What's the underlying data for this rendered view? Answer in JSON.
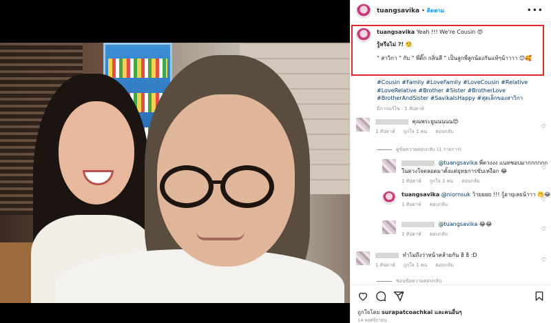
{
  "header": {
    "username": "tuangsavika",
    "separator": "•",
    "follow_label": "ติดตาม",
    "more_label": "•••"
  },
  "caption": {
    "username": "tuangsavika",
    "line1": "Yeah !!! We're Cousin 😍",
    "line2": "รู้หรือไม่ ?! 🧐",
    "line3": "\" สาวิกา \" กับ \" พี่ติ๊ก กลิ่นสี \" เป็นลูกพี่ลูกน้องกันแท้ๆน้าาาา 😊🥰",
    "hashtags": "#Cousin #Family #LoveFamily #LoveCousin #Relative #LoveRelative #Brother #Sister #BrotherLove #BrotherAndSister #SavikaIsHappy #สุดเล็กของสาวิกา",
    "translated": "มีการแก้ไข",
    "time": "1 สัปดาห์"
  },
  "comments": [
    {
      "text": "คุณพระยูนนนนน😍",
      "time": "1 สัปดาห์",
      "likes": "ถูกใจ 1 คน",
      "reply": "ตอบกลับ"
    },
    {
      "view_replies": "ดูข้อความตอบกลับ (1 รายการ)"
    },
    {
      "mention": "@tuangsavika",
      "text": "พี่ตวงงง แนทชอบมากกกกกก ในดวงใจตลอดมาตั้งแต่ยุทธการขับเหงือก 😂",
      "time": "1 สัปดาห์",
      "likes": "ถูกใจ 1 คน",
      "reply": "ตอบกลับ"
    },
    {
      "username": "tuangsavika",
      "mention": "@niornsuk",
      "text": "ว้ายยยย !!! รู้อายุเลยน้าาา 🤭😂",
      "time": "1 สัปดาห์",
      "reply": "ตอบกลับ"
    },
    {
      "mention": "@tuangsavika",
      "text": "😂😂",
      "time": "1 สัปดาห์",
      "reply": "ตอบกลับ"
    },
    {
      "text": "ทำไมถึงว่าหน้าคล้ายกัน ฮิ ฮิ :D",
      "time": "1 สัปดาห์",
      "likes": "ถูกใจ 1 คน",
      "reply": "ตอบกลับ"
    },
    {
      "view_replies": "ซ่อนข้อความตอบกลับ"
    }
  ],
  "footer": {
    "liked_by_prefix": "ถูกใจโดย",
    "liked_by_user": "surapatcoachkai",
    "liked_by_suffix": "และคนอื่นๆ",
    "date": "14 พฤศจิกายน"
  },
  "colors": {
    "accent": "#0095f6",
    "highlight_box": "#d82a2a",
    "link": "#00376b",
    "muted": "#8e8e8e"
  }
}
